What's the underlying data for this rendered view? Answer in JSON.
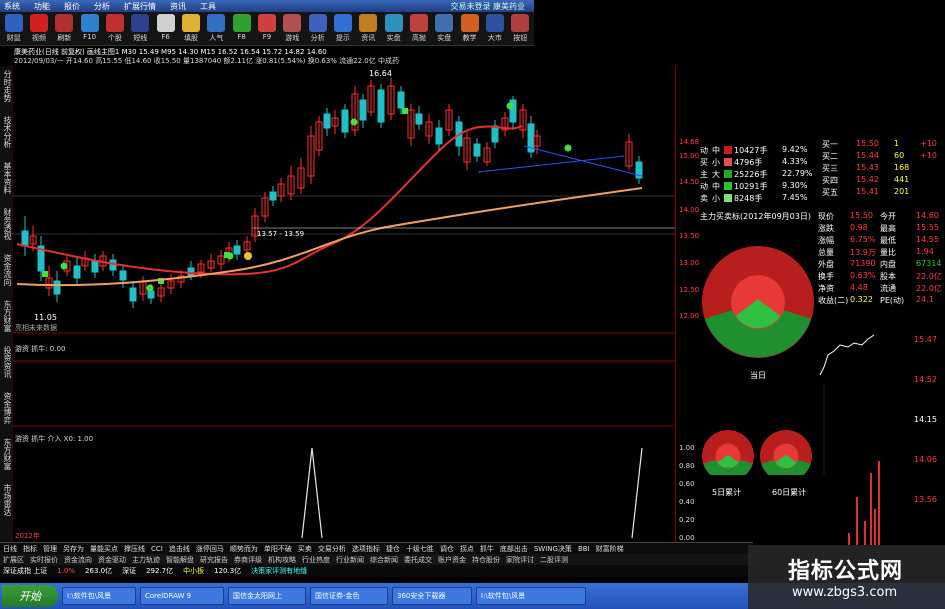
{
  "menu": [
    "系统",
    "功能",
    "报价",
    "分析",
    "扩展行情",
    "资讯",
    "工具"
  ],
  "window_title_right": "交易未登录 康美药业",
  "toolbar": [
    "财鼠",
    "视频",
    "刷新",
    "F10",
    "个股",
    "短线",
    "F6",
    "填股",
    "人气",
    "F8",
    "F9",
    "游戏",
    "分析",
    "提示",
    "资讯",
    "实盘",
    "高抛",
    "实盘",
    "教学",
    "大市",
    "按钮"
  ],
  "info": {
    "stock_line": "康美药业(日线 前复权) 画线主图1  M30 15.49  M95 14.30  M15 16.52  16.54 15.72  14.82 14.60",
    "detail_line": "2012/09/03/一 开14.60 高15.55 低14.60 收15.50 量1387040 额2.11亿 涨0.81(5.54%) 换0.63% 流通22.0亿 中成药"
  },
  "left_tabs": [
    "分时走势",
    "技术分析",
    "基本资料",
    "财务透视",
    "资金流向",
    "东方财富",
    "投资资讯",
    "资金博弈",
    "东方财富",
    "市场雷达"
  ],
  "chart": {
    "annotations": {
      "high": "16.64",
      "low": "11.05",
      "range": "13.57 - 13.59"
    },
    "sub1_label": "亮相未来数据",
    "sub2_label": "游资 抓牛: 0.00",
    "sub3_label": "游资 抓牛 介入 X0: 1.00",
    "axis_main": [
      "14.68",
      "15.00",
      "14.50",
      "14.00",
      "13.50",
      "13.00",
      "12.50",
      "12.00"
    ],
    "axis_sub": [
      "1.00",
      "0.80",
      "0.60",
      "0.40",
      "0.20",
      "0.00"
    ],
    "date_label": "2012年"
  },
  "flow_table": [
    {
      "k": "动",
      "t": "中",
      "v": "10427手",
      "p": "9.42%"
    },
    {
      "k": "买",
      "t": "小",
      "v": "4796手",
      "p": "4.33%"
    },
    {
      "k": "主",
      "t": "大",
      "v": "25226手",
      "p": "22.79%"
    },
    {
      "k": "动",
      "t": "中",
      "v": "10291手",
      "p": "9.30%"
    },
    {
      "k": "卖",
      "t": "小",
      "v": "8248手",
      "p": "7.45%"
    }
  ],
  "flow_title": "主力买卖标(2012年09月03日)",
  "pie_today": "当日",
  "pie_5": "5日累计",
  "pie_60": "60日累计",
  "bid": [
    {
      "n": "买一",
      "p": "15.50",
      "v": "1",
      "c": "+10"
    },
    {
      "n": "买二",
      "p": "15.44",
      "v": "60",
      "c": "+10"
    },
    {
      "n": "买三",
      "p": "15.43",
      "v": "168",
      "c": ""
    },
    {
      "n": "买四",
      "p": "15.42",
      "v": "441",
      "c": ""
    },
    {
      "n": "买五",
      "p": "15.41",
      "v": "201",
      "c": ""
    }
  ],
  "quote": [
    [
      "现价",
      "15.50",
      "今开",
      "14.60"
    ],
    [
      "涨跌",
      "0.98",
      "最高",
      "15.55"
    ],
    [
      "涨幅",
      "6.75%",
      "最低",
      "14.55"
    ],
    [
      "总量",
      "13.9万",
      "量比",
      "1.94"
    ],
    [
      "外盘",
      "71390",
      "内盘",
      "67314"
    ],
    [
      "换手",
      "0.63%",
      "股本",
      "22.0亿"
    ],
    [
      "净资",
      "4.48",
      "流通",
      "22.0亿"
    ],
    [
      "收益(二)",
      "0.322",
      "PE(动)",
      "24.1"
    ]
  ],
  "mini_axis": [
    "15.47",
    "14.52",
    "14.15",
    "14.06",
    "13.56"
  ],
  "bottom_tabs1": [
    "日线",
    "指标",
    "管理",
    "另存为",
    "量能买点",
    "撑压线",
    "CCI",
    "追击线",
    "涨停回马",
    "顺势而为",
    "单阳不破",
    "买卖",
    "交易分析",
    "选项指标",
    "捷仓",
    "十级七胜",
    "调仓",
    "拐点",
    "抓牛",
    "底部出击",
    "SWING决策",
    "BBI",
    "财富阶梯"
  ],
  "bottom_tabs2": [
    "扩展区",
    "实时报价",
    "资金流向",
    "资金驱动",
    "主力轨迹",
    "智能解盘",
    "研究报告",
    "券商评级",
    "机构攻略",
    "行业热度",
    "行业新闻",
    "综合新闻",
    "委托成交",
    "账户资金",
    "持仓股份",
    "家院评讨",
    "二股评测"
  ],
  "status": [
    "深证成指 上证",
    "1.0%",
    "263.0亿",
    "深证",
    "292.7亿",
    "中小板",
    "120.3亿",
    "决策家评测有地缝"
  ],
  "taskbar": [
    "开始",
    "I:\\软件包\\风景",
    "CorelDRAW 9",
    "国信金太阳网上",
    "国信证券-金色",
    "360安全下载器",
    "I:\\软件包\\风景"
  ],
  "watermark": {
    "cn": "指标公式网",
    "url": "www.zbgs3.com"
  },
  "colors": {
    "up": "#ff3c3c",
    "down": "#22d0c8",
    "ma1": "#e83030",
    "ma2": "#f0a060"
  }
}
